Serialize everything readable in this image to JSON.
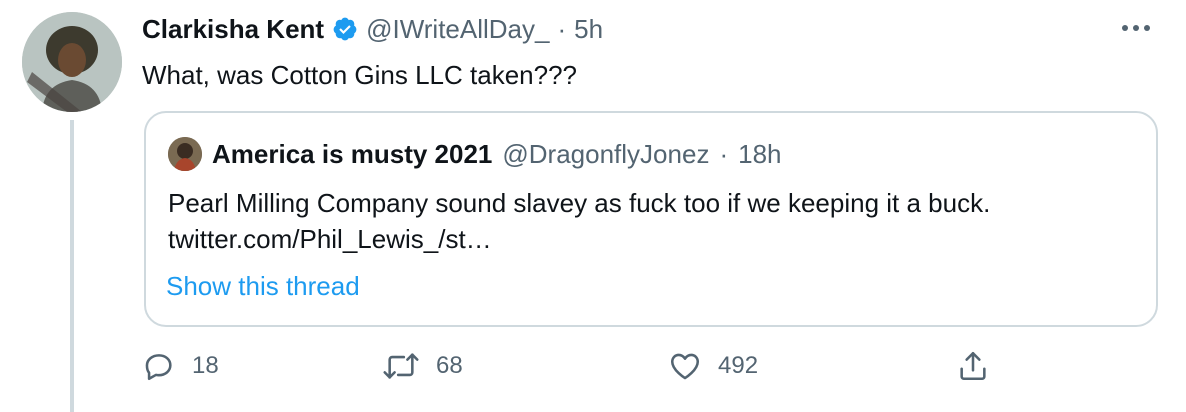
{
  "tweet": {
    "author": {
      "display_name": "Clarkisha Kent",
      "handle": "@IWriteAllDay_",
      "separator": "·",
      "time": "5h",
      "verified": true
    },
    "text": "What, was Cotton Gins LLC taken???",
    "more_icon": "more-horizontal-icon"
  },
  "quoted_tweet": {
    "display_name": "America is musty 2021",
    "handle": "@DragonflyJonez",
    "separator": "·",
    "time": "18h",
    "text": "Pearl Milling Company sound slavey as fuck too if we keeping it a buck.",
    "link_text": "twitter.com/Phil_Lewis_/st…",
    "show_thread": "Show this thread"
  },
  "actions": {
    "reply": {
      "icon": "reply-icon",
      "count": "18"
    },
    "retweet": {
      "icon": "retweet-icon",
      "count": "68"
    },
    "like": {
      "icon": "heart-icon",
      "count": "492"
    },
    "share": {
      "icon": "share-icon"
    }
  },
  "colors": {
    "text_primary": "#0f1419",
    "text_secondary": "#536471",
    "accent": "#1d9bf0",
    "border": "#cfd9de"
  }
}
